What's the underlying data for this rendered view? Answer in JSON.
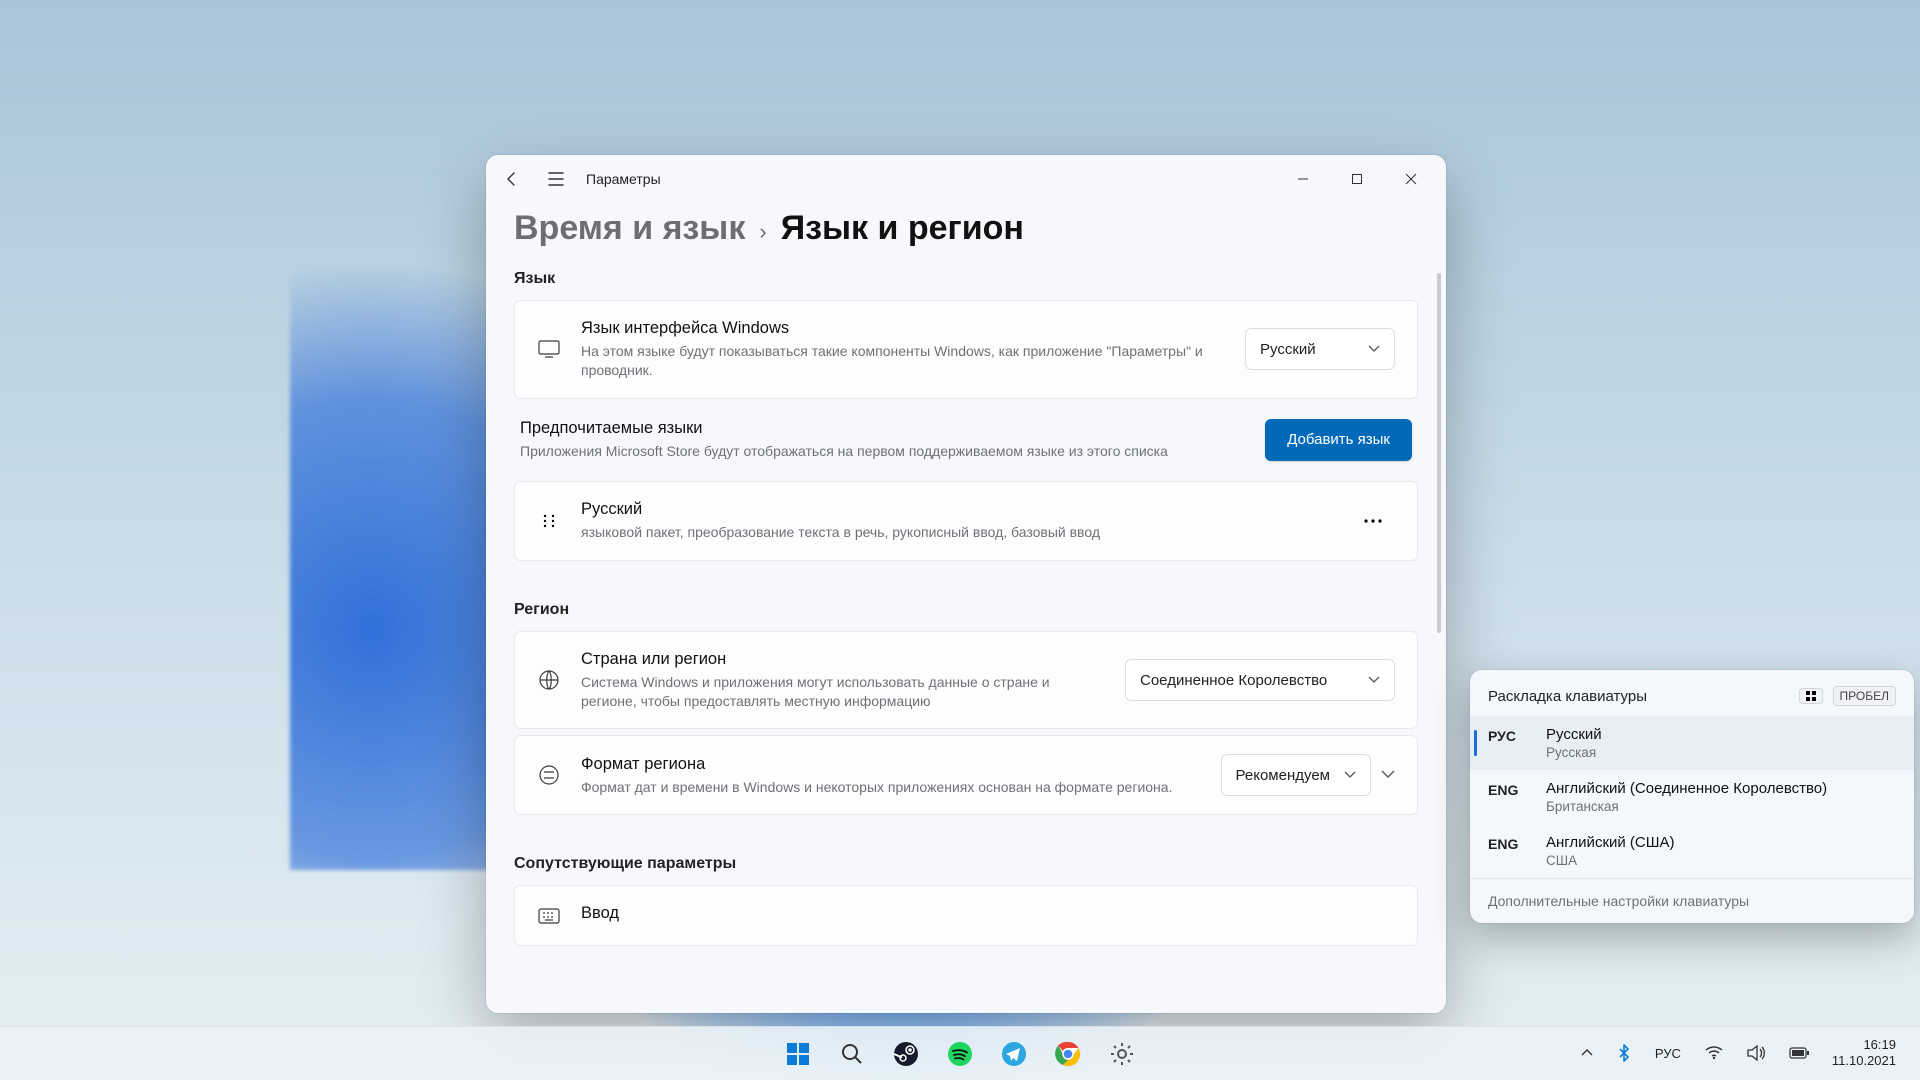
{
  "window": {
    "title": "Параметры"
  },
  "breadcrumb": {
    "parent": "Время и язык",
    "current": "Язык и регион"
  },
  "sections": {
    "language": {
      "title": "Язык",
      "display_lang": {
        "title": "Язык интерфейса Windows",
        "desc": "На этом языке будут показываться такие компоненты Windows, как приложение \"Параметры\" и проводник.",
        "value": "Русский"
      },
      "preferred": {
        "title": "Предпочитаемые языки",
        "desc": "Приложения Microsoft Store будут отображаться на первом поддерживаемом языке из этого списка",
        "add_button": "Добавить язык"
      },
      "items": [
        {
          "name": "Русский",
          "desc": "языковой пакет, преобразование текста в речь, рукописный ввод, базовый ввод"
        }
      ]
    },
    "region": {
      "title": "Регион",
      "country": {
        "title": "Страна или регион",
        "desc": "Система Windows и приложения могут использовать данные о стране и регионе, чтобы предоставлять местную информацию",
        "value": "Соединенное Королевство"
      },
      "format": {
        "title": "Формат региона",
        "desc": "Формат дат и времени в Windows и некоторых приложениях основан на формате региона.",
        "value": "Рекомендуем"
      }
    },
    "related": {
      "title": "Сопутствующие параметры",
      "typing": "Ввод"
    }
  },
  "lang_popup": {
    "title": "Раскладка клавиатуры",
    "hint_key": "ПРОБЕЛ",
    "items": [
      {
        "code": "РУС",
        "name": "Русский",
        "sub": "Русская",
        "selected": true
      },
      {
        "code": "ENG",
        "name": "Английский (Соединенное Королевство)",
        "sub": "Британская",
        "selected": false
      },
      {
        "code": "ENG",
        "name": "Английский (США)",
        "sub": "США",
        "selected": false
      }
    ],
    "footer": "Дополнительные настройки клавиатуры"
  },
  "tray": {
    "lang": "РУС",
    "time": "16:19",
    "date": "11.10.2021"
  }
}
